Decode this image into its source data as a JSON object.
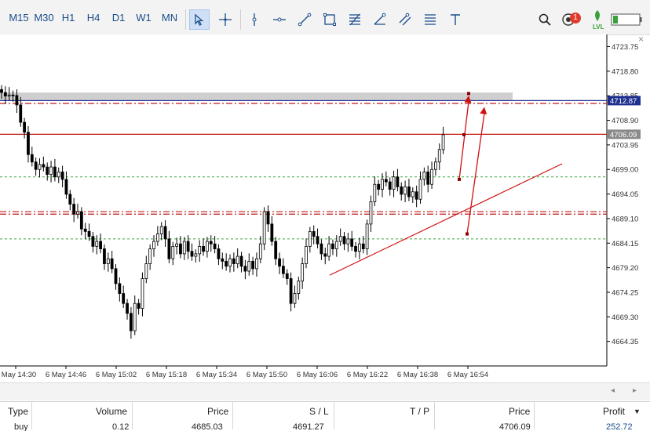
{
  "toolbar": {
    "timeframes": [
      "M15",
      "M30",
      "H1",
      "H4",
      "D1",
      "W1",
      "MN"
    ],
    "notification_count": "1",
    "lvl_label": "LVL"
  },
  "chart_data": {
    "type": "candlestick",
    "y_ticks": [
      "4723.75",
      "4718.80",
      "4713.85",
      "4708.90",
      "4703.95",
      "4699.00",
      "4694.05",
      "4689.10",
      "4684.15",
      "4679.20",
      "4674.25",
      "4669.30",
      "4664.35"
    ],
    "ylim": [
      4659.4,
      4726.2
    ],
    "x_ticks": [
      "6 May 14:30",
      "6 May 14:46",
      "6 May 15:02",
      "6 May 15:18",
      "6 May 15:34",
      "6 May 15:50",
      "6 May 16:06",
      "6 May 16:22",
      "6 May 16:38",
      "6 May 16:54"
    ],
    "bid_label": "4712.87",
    "last_price_label": "4706.09",
    "closes": [
      4714.5,
      4713.8,
      4714.0,
      4713.9,
      4712.0,
      4708.5,
      4706.5,
      4702.0,
      4700.5,
      4699.0,
      4700.0,
      4699.5,
      4698.0,
      4699.5,
      4697.5,
      4698.5,
      4697.0,
      4694.0,
      4692.0,
      4690.0,
      4690.5,
      4687.0,
      4686.5,
      4685.5,
      4683.5,
      4684.5,
      4683.0,
      4680.0,
      4681.0,
      4679.0,
      4676.0,
      4674.0,
      4672.0,
      4670.0,
      4666.5,
      4672.0,
      4671.0,
      4677.0,
      4680.0,
      4683.0,
      4684.5,
      4686.0,
      4687.5,
      4685.0,
      4681.0,
      4683.5,
      4684.0,
      4682.0,
      4684.5,
      4682.5,
      4681.5,
      4682.0,
      4683.5,
      4682.5,
      4684.5,
      4684.0,
      4683.0,
      4681.0,
      4680.5,
      4679.5,
      4681.0,
      4680.0,
      4681.5,
      4679.5,
      4678.5,
      4680.5,
      4679.0,
      4681.0,
      4684.0,
      4690.5,
      4688.0,
      4684.5,
      4681.0,
      4679.5,
      4678.0,
      4677.0,
      4672.0,
      4674.0,
      4676.5,
      4680.0,
      4683.5,
      4686.5,
      4685.5,
      4684.0,
      4682.0,
      4681.5,
      4684.0,
      4683.0,
      4684.5,
      4685.5,
      4684.0,
      4685.0,
      4683.5,
      4682.5,
      4684.0,
      4683.0,
      4688.0,
      4692.5,
      4696.0,
      4695.0,
      4697.0,
      4696.5,
      4695.0,
      4697.5,
      4695.5,
      4694.0,
      4695.5,
      4693.5,
      4694.5,
      4693.0,
      4697.0,
      4698.5,
      4696.0,
      4699.0,
      4700.5,
      4703.0,
      4706.0
    ],
    "horizontal_lines": [
      {
        "price": 4712.87,
        "style": "solid",
        "color": "#1f2f8f"
      },
      {
        "price": 4712.3,
        "style": "dashdot",
        "color": "#c01818"
      },
      {
        "price": 4706.09,
        "style": "solid",
        "color": "#c01818"
      },
      {
        "price": 4697.5,
        "style": "dashed",
        "color": "#3aa83a"
      },
      {
        "price": 4690.5,
        "style": "dashdot",
        "color": "#c01818"
      },
      {
        "price": 4690.0,
        "style": "dashdot",
        "color": "#c01818"
      },
      {
        "price": 4685.0,
        "style": "dashed",
        "color": "#3aa83a"
      }
    ],
    "zone": {
      "from": 4713.0,
      "to": 4714.5,
      "color": "#cfcfcf"
    },
    "trendline": {
      "from": [
        "6 May 16:10",
        4677.7
      ],
      "to": [
        "6 May 17:04",
        4699.6
      ],
      "color": "#d01010"
    },
    "arrows": [
      {
        "from": [
          "6 May 16:58",
          4697.0
        ],
        "to": [
          "6 May 17:00",
          4713.9
        ]
      },
      {
        "from": [
          "6 May 17:00",
          4686.0
        ],
        "to": [
          "6 May 17:04",
          4711.6
        ]
      }
    ],
    "grid": false
  },
  "table": {
    "headers": [
      "Type",
      "Volume",
      "Price",
      "S / L",
      "T / P",
      "Price",
      "Profit"
    ],
    "row": [
      "buy",
      "0.12",
      "4685.03",
      "4691.27",
      "",
      "4706.09",
      "252.72"
    ]
  },
  "colors": {
    "bull": "#ffffff",
    "bear": "#000000",
    "accent": "#1a4c8c",
    "loss": "#c01818",
    "profit": "#1a4c8c",
    "level": "#3aa83a"
  },
  "icons": [
    "cursor-icon",
    "crosshair-icon",
    "vertical-line-icon",
    "horizontal-line-icon",
    "trend-line-icon",
    "rectangle-icon",
    "fibonacci-icon",
    "angle-icon",
    "channel-icon",
    "lines-icon",
    "text-icon",
    "search-icon",
    "notifications-icon",
    "level-icon",
    "battery-icon"
  ]
}
